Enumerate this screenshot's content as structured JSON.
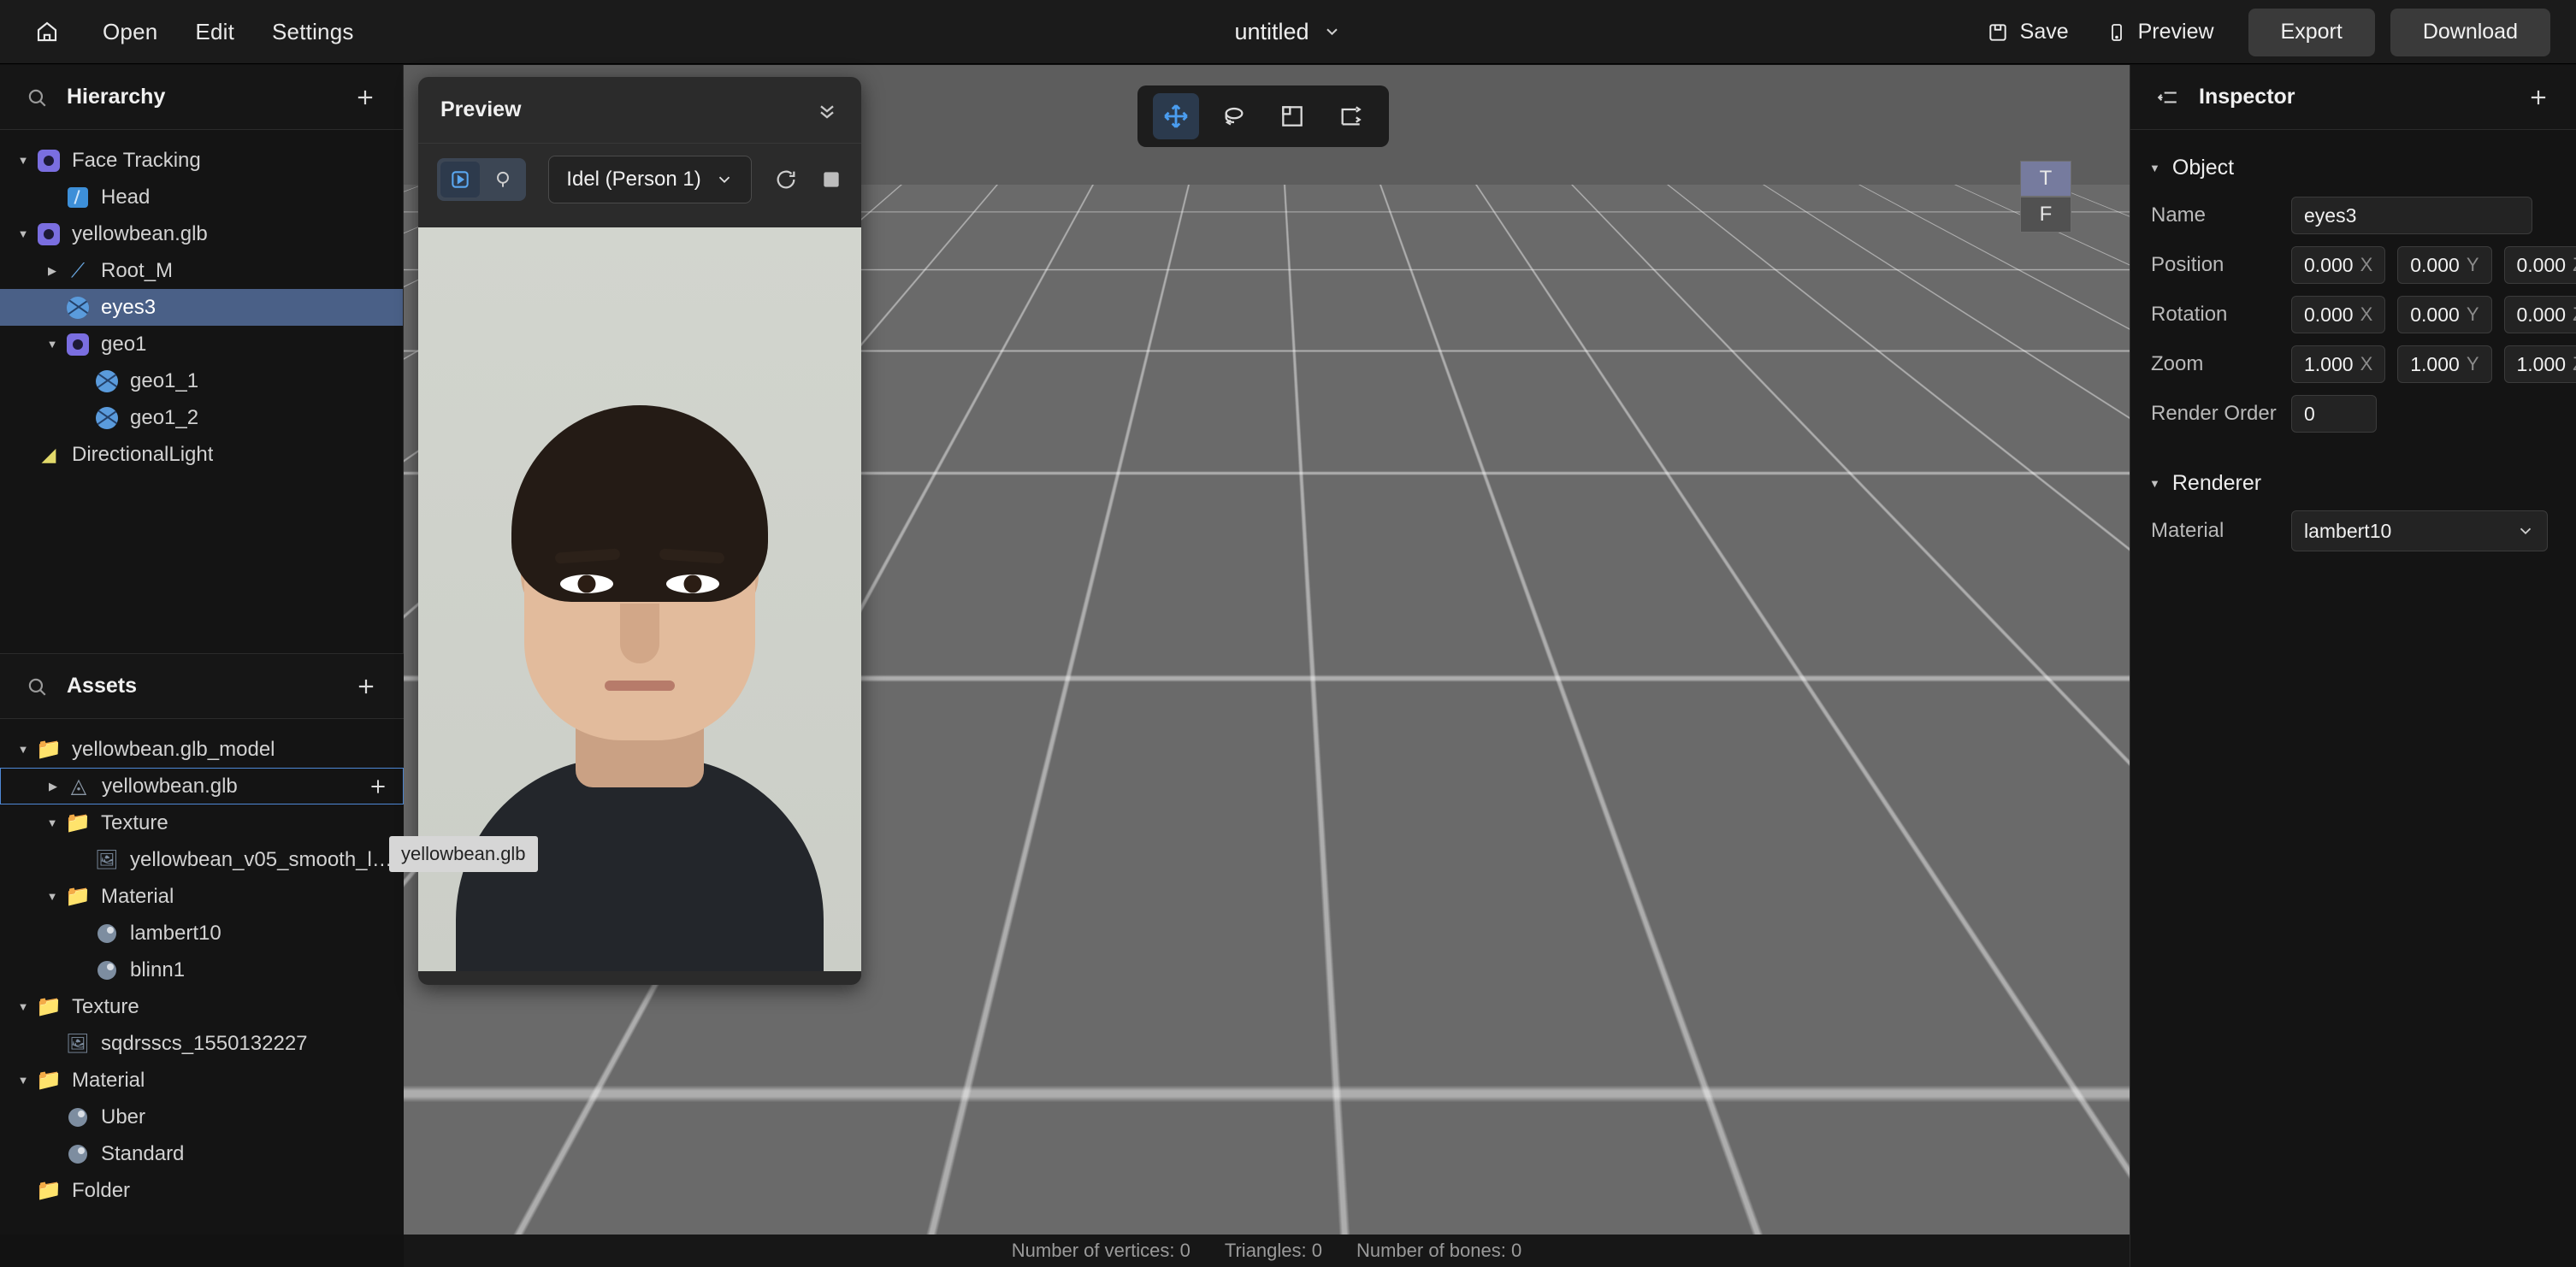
{
  "topbar": {
    "home_icon": "home-icon",
    "menus": [
      "Open",
      "Edit",
      "Settings"
    ],
    "doc_title": "untitled",
    "doc_caret": "chevron-down-icon",
    "save_label": "Save",
    "preview_label": "Preview",
    "export_label": "Export",
    "download_label": "Download"
  },
  "hierarchy": {
    "title": "Hierarchy",
    "search_icon": "search-icon",
    "add_icon": "plus-icon",
    "nodes": [
      {
        "label": "Face Tracking",
        "icon": "group-icon",
        "depth": 0,
        "caret": "down",
        "selected": false
      },
      {
        "label": "Head",
        "icon": "head-icon",
        "depth": 1,
        "caret": "none",
        "selected": false
      },
      {
        "label": "yellowbean.glb",
        "icon": "group-icon",
        "depth": 0,
        "caret": "down",
        "selected": false
      },
      {
        "label": "Root_M",
        "icon": "bone-icon",
        "depth": 1,
        "caret": "right",
        "selected": false
      },
      {
        "label": "eyes3",
        "icon": "mesh-icon",
        "depth": 1,
        "caret": "none",
        "selected": true
      },
      {
        "label": "geo1",
        "icon": "group-icon",
        "depth": 1,
        "caret": "down",
        "selected": false
      },
      {
        "label": "geo1_1",
        "icon": "mesh-icon",
        "depth": 2,
        "caret": "none",
        "selected": false
      },
      {
        "label": "geo1_2",
        "icon": "mesh-icon",
        "depth": 2,
        "caret": "none",
        "selected": false
      },
      {
        "label": "DirectionalLight",
        "icon": "light-icon",
        "depth": 0,
        "caret": "none",
        "selected": false
      }
    ]
  },
  "assets": {
    "title": "Assets",
    "search_icon": "search-icon",
    "add_icon": "plus-icon",
    "tooltip": "yellowbean.glb",
    "nodes": [
      {
        "label": "yellowbean.glb_model",
        "icon": "folder-icon",
        "depth": 0,
        "caret": "down",
        "boxed": false,
        "plus": false
      },
      {
        "label": "yellowbean.glb",
        "icon": "cube-icon",
        "depth": 1,
        "caret": "right",
        "boxed": true,
        "plus": true
      },
      {
        "label": "Texture",
        "icon": "folder-icon",
        "depth": 1,
        "caret": "down",
        "boxed": false,
        "plus": false
      },
      {
        "label": "yellowbean_v05_smooth_lam...",
        "icon": "image-icon",
        "depth": 2,
        "caret": "none",
        "boxed": false,
        "plus": false
      },
      {
        "label": "Material",
        "icon": "folder-icon",
        "depth": 1,
        "caret": "down",
        "boxed": false,
        "plus": false
      },
      {
        "label": "lambert10",
        "icon": "material-icon",
        "depth": 2,
        "caret": "none",
        "boxed": false,
        "plus": false
      },
      {
        "label": "blinn1",
        "icon": "material-icon",
        "depth": 2,
        "caret": "none",
        "boxed": false,
        "plus": false
      },
      {
        "label": "Texture",
        "icon": "folder-icon",
        "depth": 0,
        "caret": "down",
        "boxed": false,
        "plus": false
      },
      {
        "label": "sqdrsscs_1550132227",
        "icon": "image-icon",
        "depth": 1,
        "caret": "none",
        "boxed": false,
        "plus": false
      },
      {
        "label": "Material",
        "icon": "folder-icon",
        "depth": 0,
        "caret": "down",
        "boxed": false,
        "plus": false
      },
      {
        "label": "Uber",
        "icon": "material-icon",
        "depth": 1,
        "caret": "none",
        "boxed": false,
        "plus": false
      },
      {
        "label": "Standard",
        "icon": "material-icon",
        "depth": 1,
        "caret": "none",
        "boxed": false,
        "plus": false
      },
      {
        "label": "Folder",
        "icon": "folder-icon",
        "depth": 0,
        "caret": "none",
        "boxed": false,
        "plus": false
      }
    ]
  },
  "preview": {
    "title": "Preview",
    "collapse_icon": "chevrons-down-icon",
    "play_icon": "play-square-icon",
    "light_icon": "light-bulb-icon",
    "animation": "Idel (Person 1)",
    "animation_caret": "chevron-down-icon",
    "reset_icon": "refresh-icon",
    "stop_icon": "stop-square-icon"
  },
  "viewport": {
    "tools": [
      {
        "name": "move-tool",
        "active": true
      },
      {
        "name": "rotate-tool",
        "active": false
      },
      {
        "name": "scale-tool",
        "active": false
      },
      {
        "name": "transform-tool",
        "active": false
      }
    ],
    "axis_labels": [
      "T",
      "F"
    ],
    "status": {
      "vertices": "Number of vertices: 0",
      "triangles": "Triangles: 0",
      "bones": "Number of bones: 0"
    }
  },
  "inspector": {
    "title": "Inspector",
    "collapse_icon": "panel-collapse-icon",
    "add_icon": "plus-icon",
    "object_section": "Object",
    "renderer_section": "Renderer",
    "labels": {
      "name": "Name",
      "position": "Position",
      "rotation": "Rotation",
      "zoom": "Zoom",
      "render_order": "Render Order",
      "material": "Material"
    },
    "values": {
      "name": "eyes3",
      "position": {
        "x": "0.000",
        "y": "0.000",
        "z": "0.000"
      },
      "rotation": {
        "x": "0.000",
        "y": "0.000",
        "z": "0.000"
      },
      "zoom": {
        "x": "1.000",
        "y": "1.000",
        "z": "1.000"
      },
      "render_order": "0",
      "material": "lambert10"
    },
    "axis_tags": {
      "x": "X",
      "y": "Y",
      "z": "Z"
    }
  },
  "colors": {
    "accent_blue": "#4e88d6",
    "selection_blue": "#4a6087",
    "gizmo_x": "#ef2b2b",
    "gizmo_y": "#5ff05f",
    "gizmo_z": "#1b1bee",
    "panel_bg": "#141414",
    "topbar_bg": "#1b1b1b"
  }
}
